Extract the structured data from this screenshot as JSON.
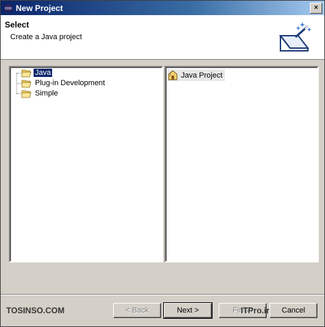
{
  "window": {
    "title": "New Project",
    "close_glyph": "×"
  },
  "header": {
    "title": "Select",
    "description": "Create a Java project",
    "icon": "wizard-wand-icon"
  },
  "categories": [
    {
      "label": "Java",
      "icon": "folder-open-icon",
      "selected": true
    },
    {
      "label": "Plug-in Development",
      "icon": "folder-icon",
      "selected": false
    },
    {
      "label": "Simple",
      "icon": "folder-icon",
      "selected": false
    }
  ],
  "wizards": [
    {
      "label": "Java Project",
      "icon": "java-project-icon"
    }
  ],
  "buttons": {
    "back": "< Back",
    "next": "Next >",
    "finish": "Finish",
    "cancel": "Cancel"
  },
  "watermarks": {
    "left": "TOSINSO.COM",
    "right": "ITPro.ir"
  },
  "colors": {
    "selection": "#0a246a",
    "titlebar": "#0a246a",
    "face": "#d4d0c8"
  }
}
